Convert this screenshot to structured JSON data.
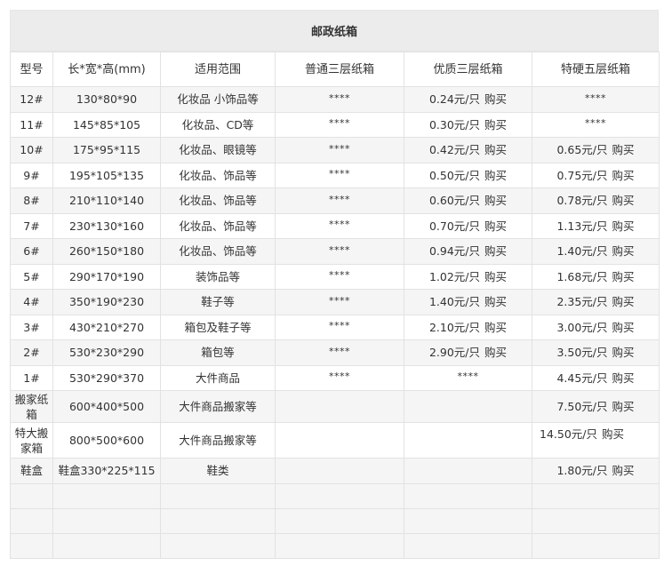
{
  "title": "邮政纸箱",
  "headers": [
    "型号",
    "长*宽*高(mm)",
    "适用范围",
    "普通三层纸箱",
    "优质三层纸箱",
    "特硬五层纸箱"
  ],
  "buy_label": "购买",
  "rows": [
    {
      "model": "12#",
      "size": "130*80*90",
      "usage": "化妆品 小饰品等",
      "normal": "****",
      "quality": "0.24元/只",
      "hard": "****"
    },
    {
      "model": "11#",
      "size": "145*85*105",
      "usage": "化妆品、CD等",
      "normal": "****",
      "quality": "0.30元/只",
      "hard": "****"
    },
    {
      "model": "10#",
      "size": "175*95*115",
      "usage": "化妆品、眼镜等",
      "normal": "****",
      "quality": "0.42元/只",
      "hard": "0.65元/只"
    },
    {
      "model": "9#",
      "size": "195*105*135",
      "usage": "化妆品、饰品等",
      "normal": "****",
      "quality": "0.50元/只",
      "hard": "0.75元/只"
    },
    {
      "model": "8#",
      "size": "210*110*140",
      "usage": "化妆品、饰品等",
      "normal": "****",
      "quality": "0.60元/只",
      "hard": "0.78元/只"
    },
    {
      "model": "7#",
      "size": "230*130*160",
      "usage": "化妆品、饰品等",
      "normal": "****",
      "quality": "0.70元/只",
      "hard": "1.13元/只"
    },
    {
      "model": "6#",
      "size": "260*150*180",
      "usage": "化妆品、饰品等",
      "normal": "****",
      "quality": "0.94元/只",
      "hard": "1.40元/只"
    },
    {
      "model": "5#",
      "size": "290*170*190",
      "usage": "装饰品等",
      "normal": "****",
      "quality": "1.02元/只",
      "hard": "1.68元/只"
    },
    {
      "model": "4#",
      "size": "350*190*230",
      "usage": "鞋子等",
      "normal": "****",
      "quality": "1.40元/只",
      "hard": "2.35元/只"
    },
    {
      "model": "3#",
      "size": "430*210*270",
      "usage": "箱包及鞋子等",
      "normal": "****",
      "quality": "2.10元/只",
      "hard": "3.00元/只"
    },
    {
      "model": "2#",
      "size": "530*230*290",
      "usage": "箱包等",
      "normal": "****",
      "quality": "2.90元/只",
      "hard": "3.50元/只"
    },
    {
      "model": "1#",
      "size": "530*290*370",
      "usage": "大件商品",
      "normal": "****",
      "quality": "****",
      "hard": "4.45元/只"
    },
    {
      "model": "搬家纸箱",
      "size": "600*400*500",
      "usage": "大件商品搬家等",
      "normal": "",
      "quality": "",
      "hard": "7.50元/只"
    },
    {
      "model": "特大搬家箱",
      "size": "800*500*600",
      "usage": "大件商品搬家等",
      "normal": "",
      "quality": "",
      "hard": "14.50元/只"
    },
    {
      "model": "鞋盒",
      "size": "鞋盒330*225*115",
      "usage": "鞋类",
      "normal": "",
      "quality": "",
      "hard": "1.80元/只"
    }
  ],
  "empty_rows": 3
}
